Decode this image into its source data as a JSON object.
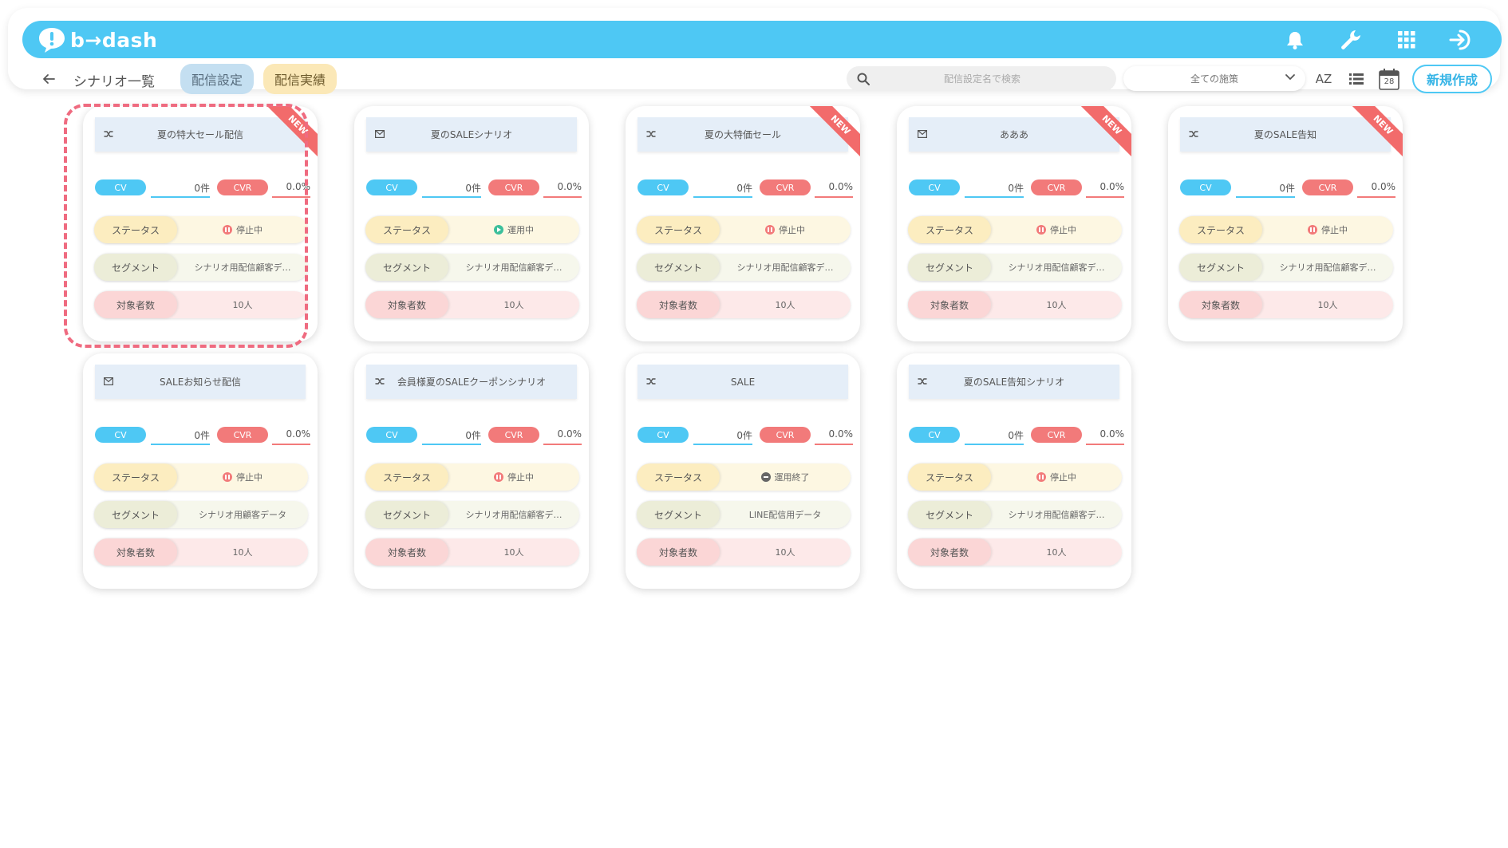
{
  "app": {
    "logo_text": "b→dash"
  },
  "header": {
    "icons": [
      "bell-icon",
      "wrench-icon",
      "grid-icon",
      "logout-icon"
    ]
  },
  "subbar": {
    "breadcrumb": "シナリオ一覧",
    "tabs": [
      {
        "label": "配信設定",
        "active": true
      },
      {
        "label": "配信実績",
        "active": false
      }
    ],
    "search_placeholder": "配信設定名で検索",
    "filter_selected": "全ての施策",
    "calendar_day": "28",
    "sort_label": "AZ",
    "new_button": "新規作成"
  },
  "labels": {
    "cv": "CV",
    "cvr": "CVR",
    "status": "ステータス",
    "segment": "セグメント",
    "target": "対象者数"
  },
  "colors": {
    "accent": "#4ec8f4",
    "cvr": "#f27a7a",
    "tab_active": "#c4dff1",
    "tab_other": "#fbe8b7",
    "new_ribbon": "#f26b6b",
    "selection": "#ef6b80"
  },
  "cards": [
    {
      "title": "夏の特大セール配信",
      "type_icon": "shuffle-icon",
      "is_new": true,
      "badge": "NEW",
      "cv": "0件",
      "cvr": "0.0%",
      "status": "停止中",
      "status_kind": "stopped",
      "segment": "シナリオ用配信顧客デ…",
      "target": "10人",
      "selected": true
    },
    {
      "title": "夏のSALEシナリオ",
      "type_icon": "mail-icon",
      "is_new": false,
      "badge": "",
      "cv": "0件",
      "cvr": "0.0%",
      "status": "運用中",
      "status_kind": "running",
      "segment": "シナリオ用配信顧客デ…",
      "target": "10人",
      "selected": false
    },
    {
      "title": "夏の大特価セール",
      "type_icon": "shuffle-icon",
      "is_new": true,
      "badge": "NEW",
      "cv": "0件",
      "cvr": "0.0%",
      "status": "停止中",
      "status_kind": "stopped",
      "segment": "シナリオ用配信顧客デ…",
      "target": "10人",
      "selected": false
    },
    {
      "title": "あああ",
      "type_icon": "mail-icon",
      "is_new": true,
      "badge": "NEW",
      "cv": "0件",
      "cvr": "0.0%",
      "status": "停止中",
      "status_kind": "stopped",
      "segment": "シナリオ用配信顧客デ…",
      "target": "10人",
      "selected": false
    },
    {
      "title": "夏のSALE告知",
      "type_icon": "shuffle-icon",
      "is_new": true,
      "badge": "NEW",
      "cv": "0件",
      "cvr": "0.0%",
      "status": "停止中",
      "status_kind": "stopped",
      "segment": "シナリオ用配信顧客デ…",
      "target": "10人",
      "selected": false
    },
    {
      "title": "SALEお知らせ配信",
      "type_icon": "mail-icon",
      "is_new": false,
      "badge": "",
      "cv": "0件",
      "cvr": "0.0%",
      "status": "停止中",
      "status_kind": "stopped",
      "segment": "シナリオ用顧客データ",
      "target": "10人",
      "selected": false
    },
    {
      "title": "会員様夏のSALEクーポンシナリオ",
      "type_icon": "shuffle-icon",
      "is_new": false,
      "badge": "",
      "cv": "0件",
      "cvr": "0.0%",
      "status": "停止中",
      "status_kind": "stopped",
      "segment": "シナリオ用配信顧客デ…",
      "target": "10人",
      "selected": false
    },
    {
      "title": "SALE",
      "type_icon": "shuffle-icon",
      "is_new": false,
      "badge": "",
      "cv": "0件",
      "cvr": "0.0%",
      "status": "運用終了",
      "status_kind": "ended",
      "segment": "LINE配信用データ",
      "target": "10人",
      "selected": false
    },
    {
      "title": "夏のSALE告知シナリオ",
      "type_icon": "shuffle-icon",
      "is_new": false,
      "badge": "",
      "cv": "0件",
      "cvr": "0.0%",
      "status": "停止中",
      "status_kind": "stopped",
      "segment": "シナリオ用配信顧客デ…",
      "target": "10人",
      "selected": false
    }
  ]
}
